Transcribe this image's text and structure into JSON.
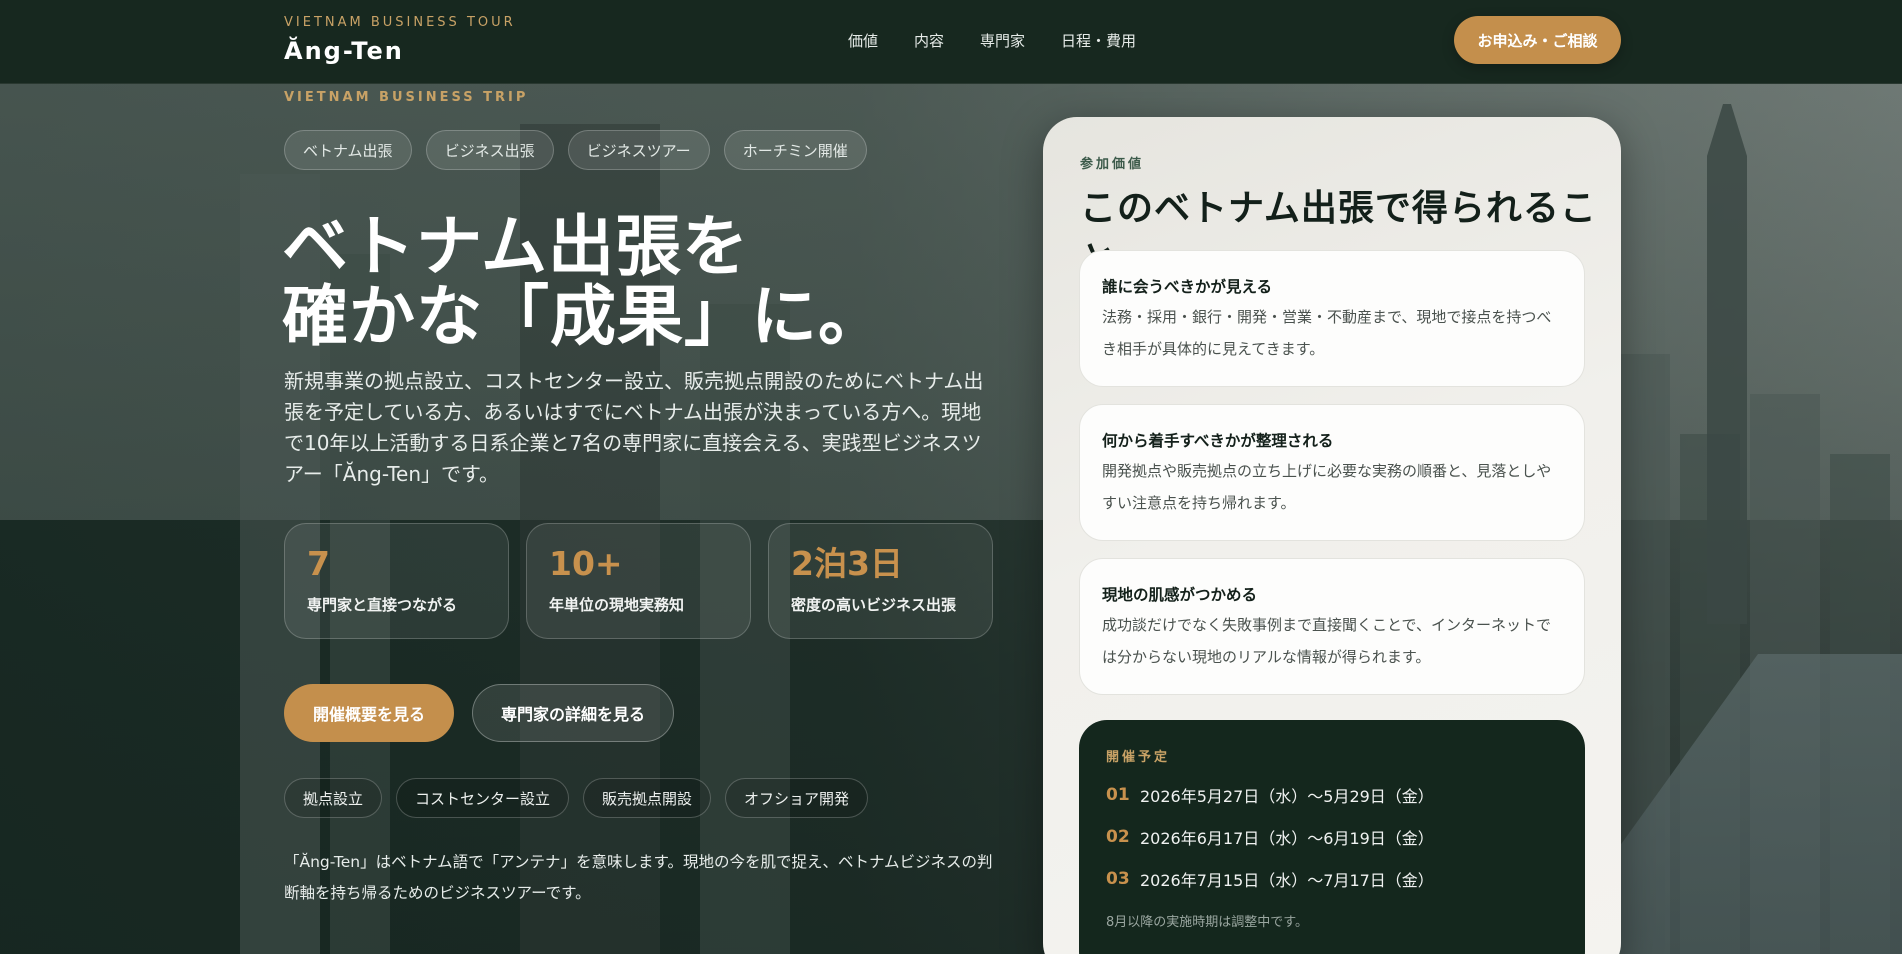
{
  "header": {
    "brand_kicker": "VIETNAM BUSINESS TOUR",
    "brand_name": "Ăng-Ten",
    "nav": [
      "価値",
      "内容",
      "専門家",
      "日程・費用"
    ],
    "cta": "お申込み・ご相談"
  },
  "hero": {
    "kicker": "VIETNAM BUSINESS TRIP",
    "tags": [
      "ベトナム出張",
      "ビジネス出張",
      "ビジネスツアー",
      "ホーチミン開催"
    ],
    "title_line1": "ベトナム出張を",
    "title_line2": "確かな「成果」に。",
    "lead": "新規事業の拠点設立、コストセンター設立、販売拠点開設のためにベトナム出張を予定している方、あるいはすでにベトナム出張が決まっている方へ。現地で10年以上活動する日系企業と7名の専門家に直接会える、実践型ビジネスツアー「Ăng-Ten」です。",
    "stats": [
      {
        "num": "7",
        "label": "専門家と直接つながる"
      },
      {
        "num": "10+",
        "label": "年単位の現地実務知"
      },
      {
        "num": "2泊3日",
        "label": "密度の高いビジネス出張"
      }
    ],
    "btn_primary": "開催概要を見る",
    "btn_secondary": "専門家の詳細を見る",
    "pills": [
      "拠点設立",
      "コストセンター設立",
      "販売拠点開設",
      "オフショア開発"
    ],
    "note": "「Ăng-Ten」はベトナム語で「アンテナ」を意味します。現地の今を肌で捉え、ベトナムビジネスの判断軸を持ち帰るためのビジネスツアーです。"
  },
  "card": {
    "kicker": "参加価値",
    "title": "このベトナム出張で得られること",
    "benefits": [
      {
        "title": "誰に会うべきかが見える",
        "desc": "法務・採用・銀行・開発・営業・不動産まで、現地で接点を持つべき相手が具体的に見えてきます。"
      },
      {
        "title": "何から着手すべきかが整理される",
        "desc": "開発拠点や販売拠点の立ち上げに必要な実務の順番と、見落としやすい注意点を持ち帰れます。"
      },
      {
        "title": "現地の肌感がつかめる",
        "desc": "成功談だけでなく失敗事例まで直接聞くことで、インターネットでは分からない現地のリアルな情報が得られます。"
      }
    ],
    "schedule": {
      "kicker": "開催予定",
      "rows": [
        {
          "n": "01",
          "date": "2026年5月27日（水）〜5月29日（金）"
        },
        {
          "n": "02",
          "date": "2026年6月17日（水）〜6月19日（金）"
        },
        {
          "n": "03",
          "date": "2026年7月15日（水）〜7月17日（金）"
        }
      ],
      "foot": "8月以降の実施時期は調整中です。"
    }
  },
  "colors": {
    "accent": "#c48f4c",
    "header_bg": "#17281f",
    "schedule_bg": "#14271d"
  }
}
